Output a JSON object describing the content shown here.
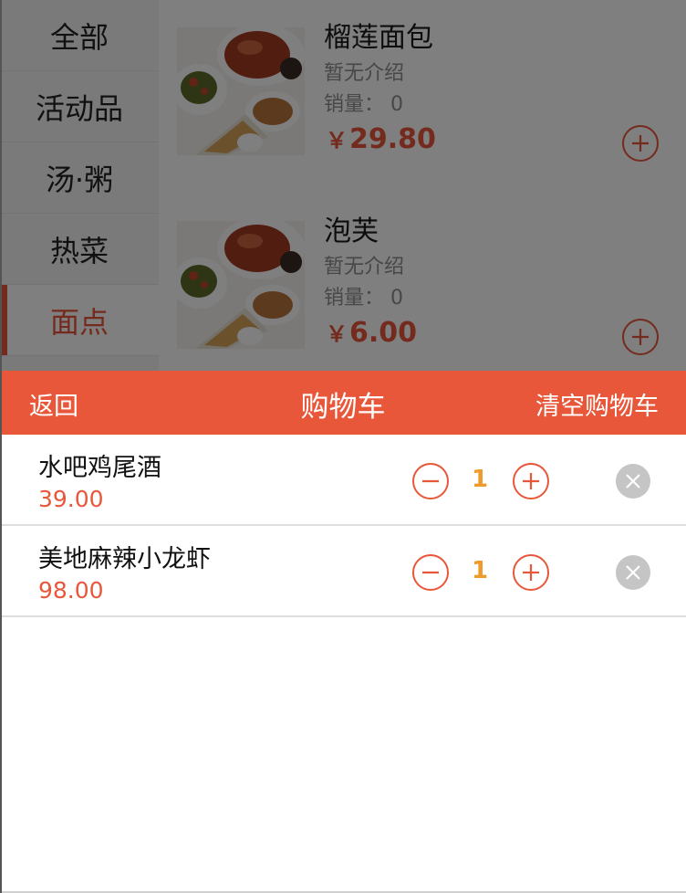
{
  "categories": [
    {
      "label": "全部"
    },
    {
      "label": "活动品"
    },
    {
      "label": "汤·粥"
    },
    {
      "label": "热菜"
    },
    {
      "label": "面点",
      "active": true
    }
  ],
  "products": [
    {
      "name": "榴莲面包",
      "desc": "暂无介绍",
      "sales": "销量：  0",
      "currency": "￥",
      "price": "29.80"
    },
    {
      "name": "泡芙",
      "desc": "暂无介绍",
      "sales": "销量：  0",
      "currency": "￥",
      "price": "6.00"
    }
  ],
  "cart": {
    "back_label": "返回",
    "title": "购物车",
    "clear_label": "清空购物车",
    "items": [
      {
        "name": "水吧鸡尾酒",
        "price": "39.00",
        "qty": "1"
      },
      {
        "name": "美地麻辣小龙虾",
        "price": "98.00",
        "qty": "1"
      }
    ]
  },
  "colors": {
    "accent": "#e8573a",
    "qty": "#ef9a2c",
    "remove": "#c5c5c5"
  },
  "icons": {
    "add": "plus-circle-icon",
    "minus": "minus-circle-icon",
    "remove": "close-circle-icon"
  }
}
